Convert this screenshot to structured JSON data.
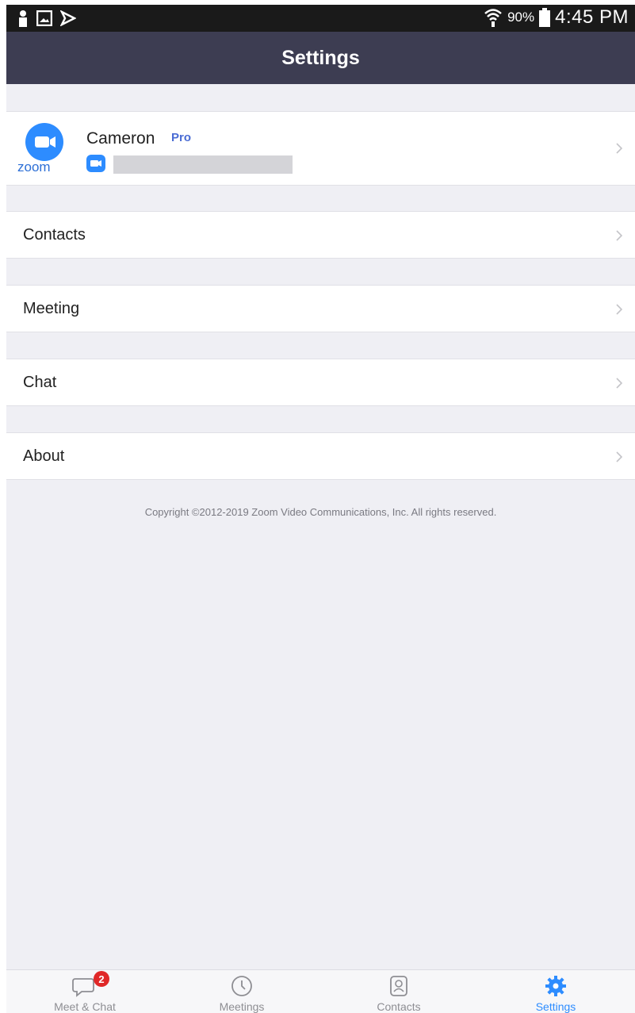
{
  "status_bar": {
    "battery": "90%",
    "time": "4:45 PM"
  },
  "header": {
    "title": "Settings"
  },
  "profile": {
    "name": "Cameron",
    "badge": "Pro",
    "avatar_text": "zoom"
  },
  "menu": {
    "items": [
      {
        "label": "Contacts"
      },
      {
        "label": "Meeting"
      },
      {
        "label": "Chat"
      },
      {
        "label": "About"
      }
    ]
  },
  "copyright": "Copyright ©2012-2019 Zoom Video Communications, Inc. All rights reserved.",
  "tabs": [
    {
      "label": "Meet & Chat",
      "badge": "2",
      "icon": "chat-bubble-icon"
    },
    {
      "label": "Meetings",
      "icon": "clock-icon"
    },
    {
      "label": "Contacts",
      "icon": "contact-card-icon"
    },
    {
      "label": "Settings",
      "icon": "gear-icon",
      "active": true
    }
  ],
  "colors": {
    "header_bg": "#3d3d52",
    "accent": "#2d8cff",
    "badge": "#e02828",
    "pro_badge": "#4a6cd4"
  }
}
